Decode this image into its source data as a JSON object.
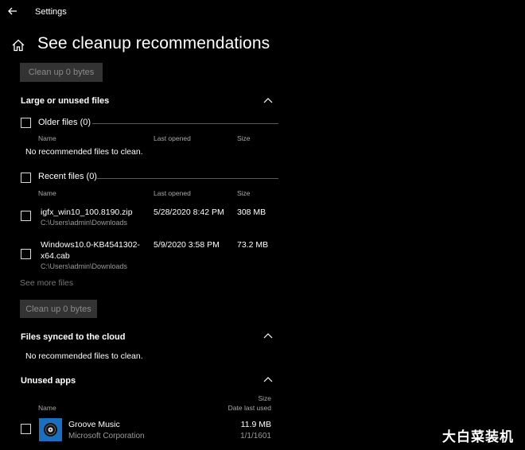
{
  "window": {
    "title": "Settings"
  },
  "page": {
    "title": "See cleanup recommendations"
  },
  "cleanup_button_top": "Clean up 0 bytes",
  "large_unused": {
    "header": "Large or unused files",
    "older": {
      "label": "Older files (0)",
      "col_name": "Name",
      "col_last_opened": "Last opened",
      "col_size": "Size",
      "empty": "No recommended files to clean."
    },
    "recent": {
      "label": "Recent files (0)",
      "col_name": "Name",
      "col_last_opened": "Last opened",
      "col_size": "Size",
      "files": [
        {
          "name": "igfx_win10_100.8190.zip",
          "path": "C:\\Users\\admin\\Downloads",
          "last_opened": "5/28/2020 8:42 PM",
          "size": "308 MB"
        },
        {
          "name_line1": "Windows10.0-KB4541302-",
          "name_line2": "x64.cab",
          "path": "C:\\Users\\admin\\Downloads",
          "last_opened": "5/9/2020 3:58 PM",
          "size": "73.2 MB"
        }
      ]
    },
    "see_more": "See more files",
    "cleanup_button": "Clean up 0 bytes"
  },
  "cloud": {
    "header": "Files synced to the cloud",
    "empty": "No recommended files to clean."
  },
  "unused_apps": {
    "header": "Unused apps",
    "col_name": "Name",
    "col_size": "Size",
    "col_date": "Date last used",
    "apps": [
      {
        "name": "Groove Music",
        "publisher": "Microsoft Corporation",
        "size": "11.9 MB",
        "date": "1/1/1601",
        "icon": "groove-music-icon"
      }
    ]
  },
  "watermark": "大白菜装机"
}
